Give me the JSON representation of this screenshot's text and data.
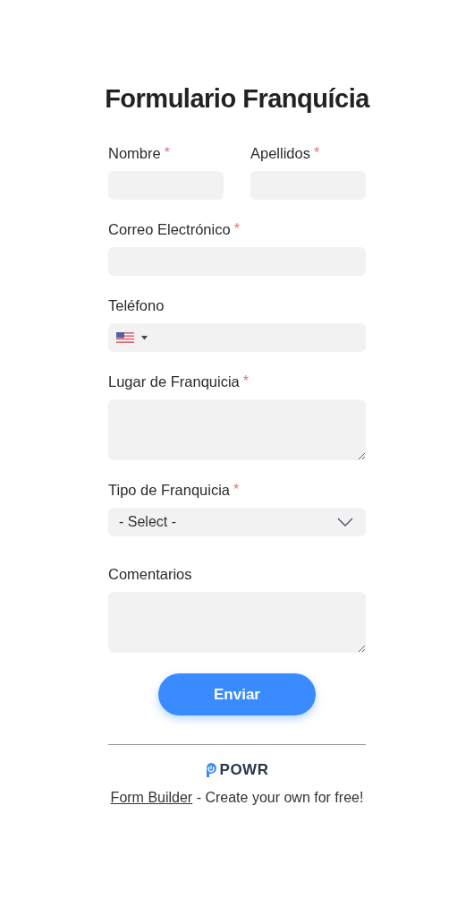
{
  "title": "Formulario Franquícia",
  "fields": [
    {
      "kind": "text",
      "label": "Nombre",
      "required": true
    },
    {
      "kind": "text",
      "label": "Apellidos",
      "required": true
    },
    {
      "kind": "text",
      "label": "Correo Electrónico",
      "required": true
    },
    {
      "kind": "phone",
      "label": "Teléfono",
      "required": false
    },
    {
      "kind": "textarea",
      "label": "Lugar de Franquicia",
      "required": true
    },
    {
      "kind": "select",
      "label": "Tipo de Franquicia",
      "required": true,
      "value": "- Select -"
    },
    {
      "kind": "textarea",
      "label": "Comentarios",
      "required": false
    }
  ],
  "required_mark": "*",
  "submit": "Enviar",
  "brand": "POWR",
  "footer": {
    "link": "Form Builder",
    "text": " - Create your own for free!"
  }
}
